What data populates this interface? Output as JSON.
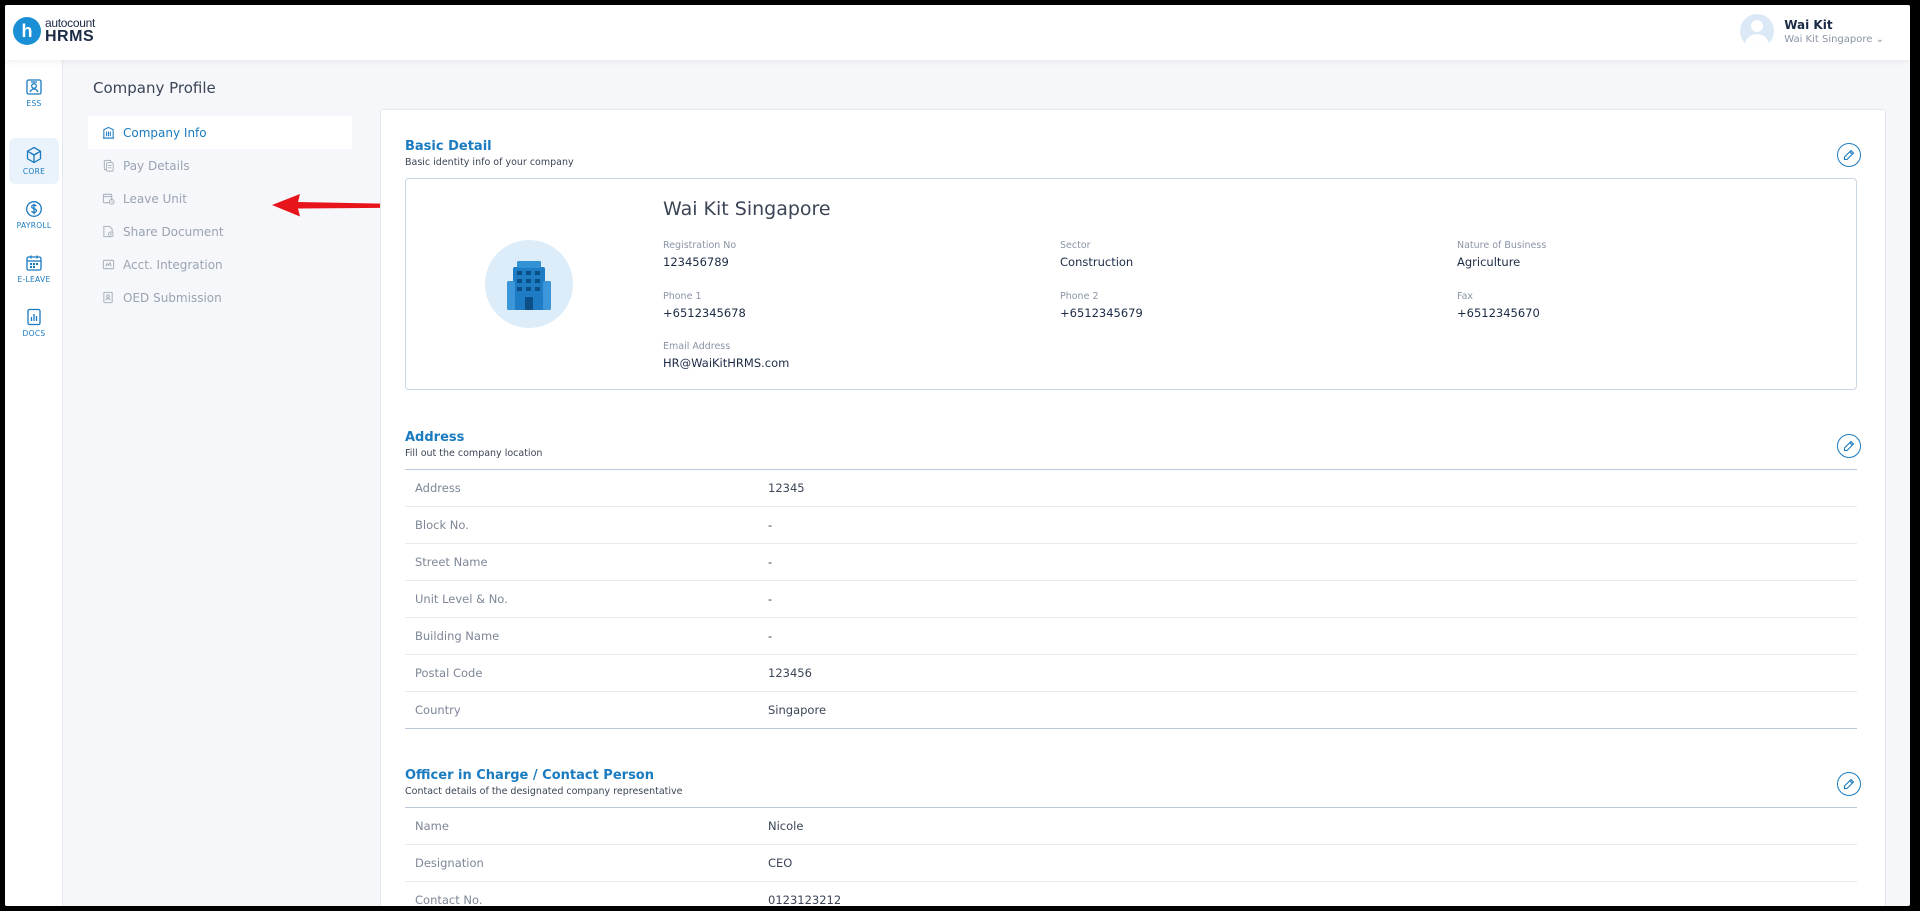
{
  "brand": {
    "sub": "autocount",
    "main": "HRMS",
    "mark": "h"
  },
  "user": {
    "name": "Wai Kit",
    "company": "Wai Kit Singapore"
  },
  "rail": [
    {
      "label": "ESS",
      "icon": "id-card-icon"
    },
    {
      "label": "CORE",
      "icon": "cube-icon"
    },
    {
      "label": "PAYROLL",
      "icon": "dollar-icon"
    },
    {
      "label": "E-LEAVE",
      "icon": "calendar-icon"
    },
    {
      "label": "DOCS",
      "icon": "chart-document-icon"
    }
  ],
  "page_title": "Company Profile",
  "menu": [
    {
      "label": "Company Info",
      "icon": "building-icon"
    },
    {
      "label": "Pay Details",
      "icon": "receipt-icon"
    },
    {
      "label": "Leave Unit",
      "icon": "calendar-clock-icon"
    },
    {
      "label": "Share Document",
      "icon": "document-share-icon"
    },
    {
      "label": "Acct. Integration",
      "icon": "integration-icon"
    },
    {
      "label": "OED Submission",
      "icon": "submission-icon"
    }
  ],
  "basic": {
    "title": "Basic Detail",
    "subtitle": "Basic identity info of your company",
    "company_name": "Wai Kit Singapore",
    "fields": {
      "registration_no": {
        "label": "Registration No",
        "value": "123456789"
      },
      "sector": {
        "label": "Sector",
        "value": "Construction"
      },
      "nature": {
        "label": "Nature of Business",
        "value": "Agriculture"
      },
      "phone1": {
        "label": "Phone 1",
        "value": "+6512345678"
      },
      "phone2": {
        "label": "Phone 2",
        "value": "+6512345679"
      },
      "fax": {
        "label": "Fax",
        "value": "+6512345670"
      },
      "email": {
        "label": "Email Address",
        "value": "HR@WaiKitHRMS.com"
      }
    }
  },
  "address": {
    "title": "Address",
    "subtitle": "Fill out the company location",
    "rows": [
      {
        "label": "Address",
        "value": "12345"
      },
      {
        "label": "Block No.",
        "value": "-"
      },
      {
        "label": "Street Name",
        "value": "-"
      },
      {
        "label": "Unit Level & No.",
        "value": "-"
      },
      {
        "label": "Building Name",
        "value": "-"
      },
      {
        "label": "Postal Code",
        "value": "123456"
      },
      {
        "label": "Country",
        "value": "Singapore"
      }
    ]
  },
  "officer": {
    "title": "Officer in Charge / Contact Person",
    "subtitle": "Contact details of the designated company representative",
    "rows": [
      {
        "label": "Name",
        "value": "Nicole"
      },
      {
        "label": "Designation",
        "value": "CEO"
      },
      {
        "label": "Contact No.",
        "value": "0123123212"
      }
    ]
  },
  "colors": {
    "accent": "#1a7bc0",
    "arrow": "#e8141c"
  }
}
